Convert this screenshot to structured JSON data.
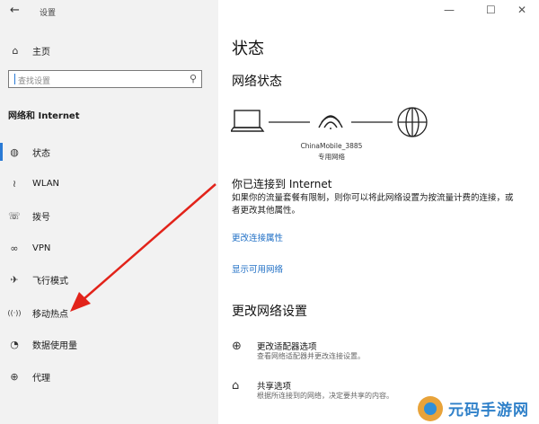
{
  "window": {
    "title": "设置",
    "back_glyph": "←",
    "minimize_glyph": "—",
    "maximize_glyph": "☐",
    "close_glyph": "✕"
  },
  "sidebar": {
    "home_label": "主页",
    "search_placeholder": "查找设置",
    "section_title": "网络和 Internet",
    "items": [
      {
        "label": "状态",
        "icon": "status-icon",
        "glyph": "◍",
        "active": true
      },
      {
        "label": "WLAN",
        "icon": "wlan-icon",
        "glyph": "≀"
      },
      {
        "label": "拨号",
        "icon": "dialup-icon",
        "glyph": "☏"
      },
      {
        "label": "VPN",
        "icon": "vpn-icon",
        "glyph": "∞"
      },
      {
        "label": "飞行模式",
        "icon": "airplane-icon",
        "glyph": "✈"
      },
      {
        "label": "移动热点",
        "icon": "hotspot-icon",
        "glyph": "((·))"
      },
      {
        "label": "数据使用量",
        "icon": "data-usage-icon",
        "glyph": "◔"
      },
      {
        "label": "代理",
        "icon": "proxy-icon",
        "glyph": "⊕"
      }
    ],
    "accent": "#2a7ad5"
  },
  "main": {
    "page_title": "状态",
    "network_status_heading": "网络状态",
    "network_name": "ChinaMobile_3885",
    "network_type": "专用网络",
    "connected_heading": "你已连接到 Internet",
    "description": "如果你的流量套餐有限制，则你可以将此网络设置为按流量计费的连接，或者更改其他属性。",
    "link_change_props": "更改连接属性",
    "link_show_networks": "显示可用网络",
    "change_settings_heading": "更改网络设置",
    "options": [
      {
        "title": "更改适配器选项",
        "subtitle": "查看网络适配器并更改连接设置。",
        "icon": "adapter-icon",
        "glyph": "⊕"
      },
      {
        "title": "共享选项",
        "subtitle": "根据所连接到的网络，决定要共享的内容。",
        "icon": "sharing-icon",
        "glyph": "⌂"
      }
    ],
    "link_color": "#1f6fc5"
  },
  "watermark": {
    "text": "元码手游网"
  }
}
